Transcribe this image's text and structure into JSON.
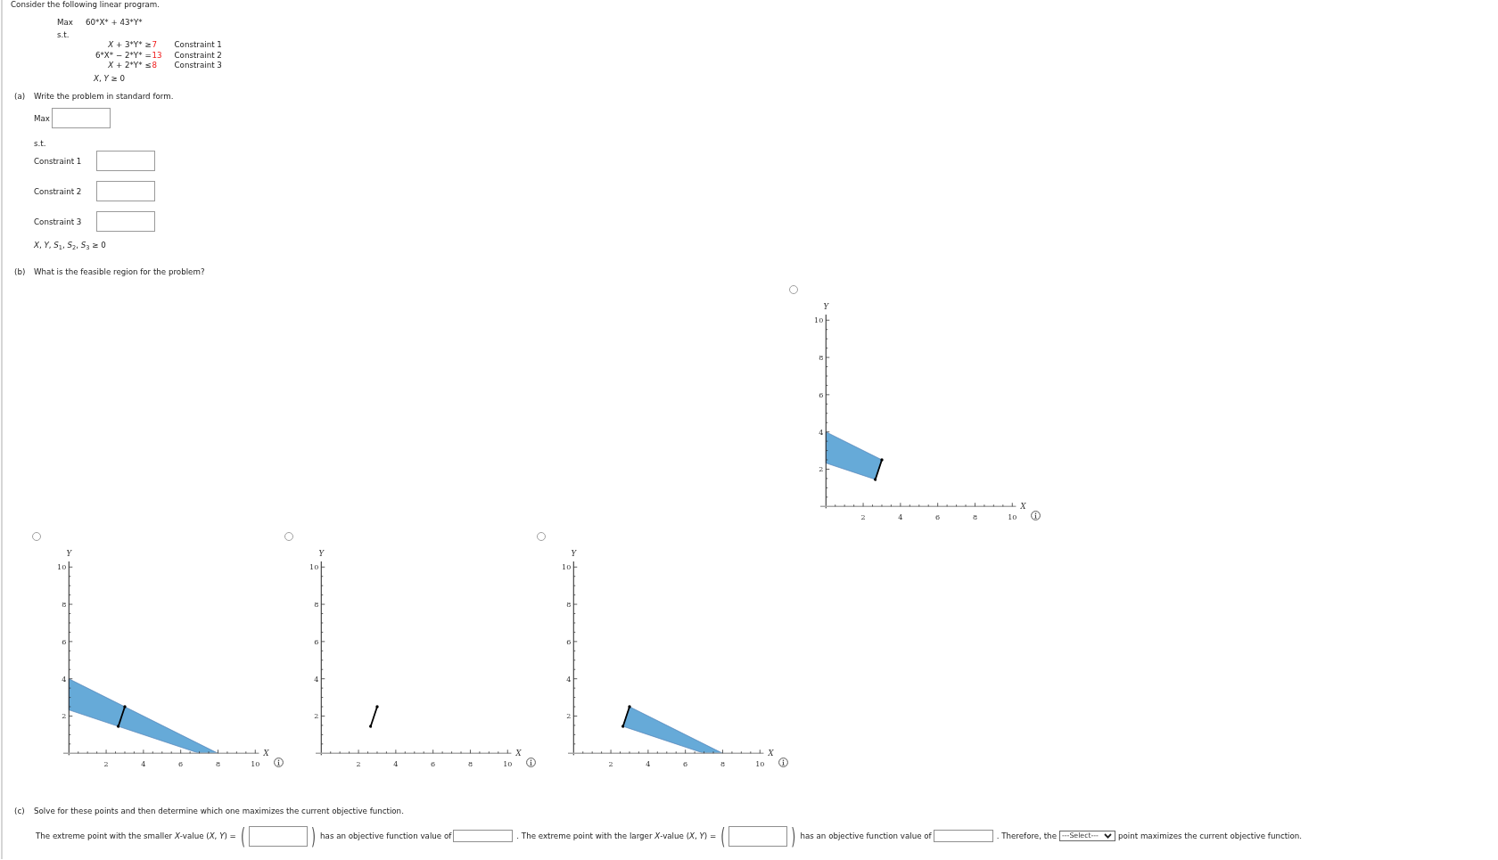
{
  "problem": {
    "intro": "Consider the following linear program.",
    "objective": {
      "sense": "Max",
      "expression": "60*X* + 43*Y*"
    },
    "subject_to": "s.t.",
    "constraints": [
      {
        "lhs": "*X* + 3*Y*",
        "operator": "≥",
        "rhs": "7",
        "label": "Constraint 1"
      },
      {
        "lhs": "6*X* − 2*Y*",
        "operator": "=",
        "rhs": "13",
        "label": "Constraint 2"
      },
      {
        "lhs": "*X* + 2*Y*",
        "operator": "≤",
        "rhs": "8",
        "label": "Constraint 3"
      }
    ],
    "nonnegativity": "*X*, *Y* ≥ 0"
  },
  "part_a": {
    "label": "(a)",
    "prompt": "Write the problem in standard form.",
    "objective_label": "Max",
    "subject_to": "s.t.",
    "constraints": [
      {
        "label": "Constraint 1"
      },
      {
        "label": "Constraint 2"
      },
      {
        "label": "Constraint 3"
      }
    ],
    "nonnegativity": "*X*, *Y*, *S*$_{1}$, *S*$_{2}$, *S*$_{3}$ ≥ 0"
  },
  "part_b": {
    "label": "(b)",
    "prompt": "What is the feasible region for the problem?",
    "options": [
      {
        "selected": false,
        "chart_data": {
          "type": "area",
          "xlabel": "X",
          "ylabel": "Y",
          "xlim": [
            -0.3,
            10.2
          ],
          "ylim": [
            -0.1,
            10.3
          ],
          "xticks": [
            {
              "value": 2,
              "label": "2"
            },
            {
              "value": 4,
              "label": "4"
            },
            {
              "value": 6,
              "label": "6"
            },
            {
              "value": 8,
              "label": "8"
            },
            {
              "value": 10,
              "label": "10"
            }
          ],
          "yticks": [
            {
              "value": 2,
              "label": "2"
            },
            {
              "value": 4,
              "label": "4"
            },
            {
              "value": 6,
              "label": "6"
            },
            {
              "value": 8,
              "label": "8"
            },
            {
              "value": 10,
              "label": "10"
            }
          ],
          "series": [
            {
              "type": "area",
              "x": [
                0,
                3,
                2.65,
                0
              ],
              "values": [
                4,
                2.5,
                1.45,
                2.33
              ],
              "color": "#66aad8"
            },
            {
              "type": "line",
              "x": [
                2.65,
                3
              ],
              "values": [
                1.45,
                2.5
              ],
              "color": "#000000"
            }
          ]
        }
      },
      {
        "selected": false,
        "chart_data": {
          "type": "area",
          "xlabel": "X",
          "ylabel": "Y",
          "xlim": [
            -0.3,
            10.2
          ],
          "ylim": [
            -0.1,
            10.3
          ],
          "xticks": [
            {
              "value": 2,
              "label": "2"
            },
            {
              "value": 4,
              "label": "4"
            },
            {
              "value": 6,
              "label": "6"
            },
            {
              "value": 8,
              "label": "8"
            },
            {
              "value": 10,
              "label": "10"
            }
          ],
          "yticks": [
            {
              "value": 2,
              "label": "2"
            },
            {
              "value": 4,
              "label": "4"
            },
            {
              "value": 6,
              "label": "6"
            },
            {
              "value": 8,
              "label": "8"
            },
            {
              "value": 10,
              "label": "10"
            }
          ],
          "series": [
            {
              "type": "area",
              "x": [
                0,
                8,
                7,
                0
              ],
              "values": [
                4,
                0,
                0,
                2.33
              ],
              "color": "#66aad8"
            },
            {
              "type": "line",
              "x": [
                2.65,
                3
              ],
              "values": [
                1.45,
                2.5
              ],
              "color": "#000000"
            }
          ]
        }
      },
      {
        "selected": false,
        "chart_data": {
          "type": "line",
          "xlabel": "X",
          "ylabel": "Y",
          "xlim": [
            -0.3,
            10.2
          ],
          "ylim": [
            -0.1,
            10.3
          ],
          "xticks": [
            {
              "value": 2,
              "label": "2"
            },
            {
              "value": 4,
              "label": "4"
            },
            {
              "value": 6,
              "label": "6"
            },
            {
              "value": 8,
              "label": "8"
            },
            {
              "value": 10,
              "label": "10"
            }
          ],
          "yticks": [
            {
              "value": 2,
              "label": "2"
            },
            {
              "value": 4,
              "label": "4"
            },
            {
              "value": 6,
              "label": "6"
            },
            {
              "value": 8,
              "label": "8"
            },
            {
              "value": 10,
              "label": "10"
            }
          ],
          "x": [
            2.65,
            3
          ],
          "values": [
            1.45,
            2.5
          ],
          "color": "#000000"
        }
      },
      {
        "selected": false,
        "chart_data": {
          "type": "area",
          "xlabel": "X",
          "ylabel": "Y",
          "xlim": [
            -0.3,
            10.2
          ],
          "ylim": [
            -0.1,
            10.3
          ],
          "xticks": [
            {
              "value": 2,
              "label": "2"
            },
            {
              "value": 4,
              "label": "4"
            },
            {
              "value": 6,
              "label": "6"
            },
            {
              "value": 8,
              "label": "8"
            },
            {
              "value": 10,
              "label": "10"
            }
          ],
          "yticks": [
            {
              "value": 2,
              "label": "2"
            },
            {
              "value": 4,
              "label": "4"
            },
            {
              "value": 6,
              "label": "6"
            },
            {
              "value": 8,
              "label": "8"
            },
            {
              "value": 10,
              "label": "10"
            }
          ],
          "series": [
            {
              "type": "area",
              "x": [
                3,
                8,
                7,
                2.65
              ],
              "values": [
                2.5,
                0,
                0,
                1.45
              ],
              "color": "#66aad8"
            },
            {
              "type": "line",
              "x": [
                2.65,
                3
              ],
              "values": [
                1.45,
                2.5
              ],
              "color": "#000000"
            }
          ]
        }
      }
    ]
  },
  "part_c": {
    "label": "(c)",
    "prompt": "Solve for these points and then determine which one maximizes the current objective function.",
    "sentence": [
      {
        "kind": "text",
        "text": "The extreme point with the smaller *X*-value (*X*, *Y*) ="
      },
      {
        "kind": "paren",
        "text": "("
      },
      {
        "kind": "point"
      },
      {
        "kind": "paren",
        "text": ")"
      },
      {
        "kind": "text",
        "text": "has an objective function value of"
      },
      {
        "kind": "number"
      },
      {
        "kind": "text",
        "text": ". The extreme point with the larger *X*-value (*X*, *Y*) ="
      },
      {
        "kind": "paren",
        "text": "("
      },
      {
        "kind": "point"
      },
      {
        "kind": "paren",
        "text": ")"
      },
      {
        "kind": "text",
        "text": "has an objective function value of"
      },
      {
        "kind": "number"
      },
      {
        "kind": "text",
        "text": ". Therefore, the"
      },
      {
        "kind": "select",
        "value": "---Select---"
      },
      {
        "kind": "text",
        "text": "point maximizes the current objective function."
      }
    ]
  }
}
